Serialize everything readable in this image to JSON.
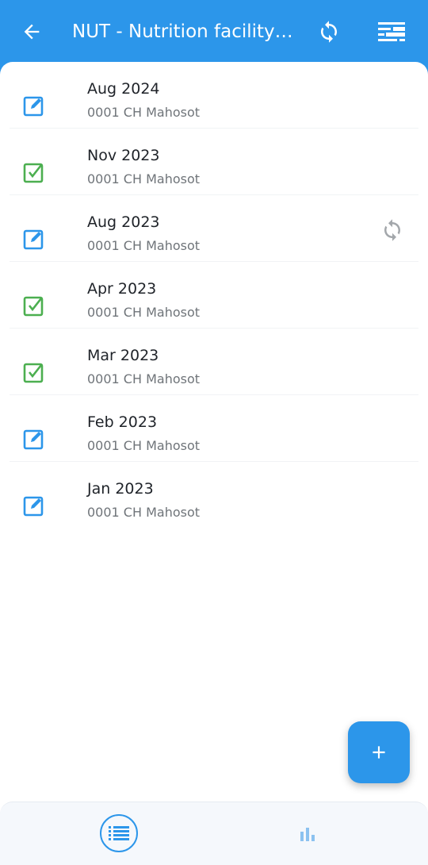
{
  "header": {
    "title": "NUT - Nutrition facility (..."
  },
  "events": [
    {
      "period": "Aug 2024",
      "org_unit": "0001 CH Mahosot",
      "status": "edit",
      "sync": false
    },
    {
      "period": "Nov 2023",
      "org_unit": "0001 CH Mahosot",
      "status": "completed",
      "sync": false
    },
    {
      "period": "Aug 2023",
      "org_unit": "0001 CH Mahosot",
      "status": "edit",
      "sync": true
    },
    {
      "period": "Apr 2023",
      "org_unit": "0001 CH Mahosot",
      "status": "completed",
      "sync": false
    },
    {
      "period": "Mar 2023",
      "org_unit": "0001 CH Mahosot",
      "status": "completed",
      "sync": false
    },
    {
      "period": "Feb 2023",
      "org_unit": "0001 CH Mahosot",
      "status": "edit",
      "sync": false
    },
    {
      "period": "Jan 2023",
      "org_unit": "0001 CH Mahosot",
      "status": "edit",
      "sync": false
    }
  ],
  "colors": {
    "primary": "#2c96ea",
    "edit_icon": "#2c96ea",
    "completed_icon": "#4caf50",
    "secondary_text": "#6f7479"
  },
  "icons": {
    "back": "arrow-back-icon",
    "sync": "sync-icon",
    "filter": "filter-icon",
    "add": "plus-icon",
    "list_tab": "list-icon",
    "analytics_tab": "bar-chart-icon"
  }
}
